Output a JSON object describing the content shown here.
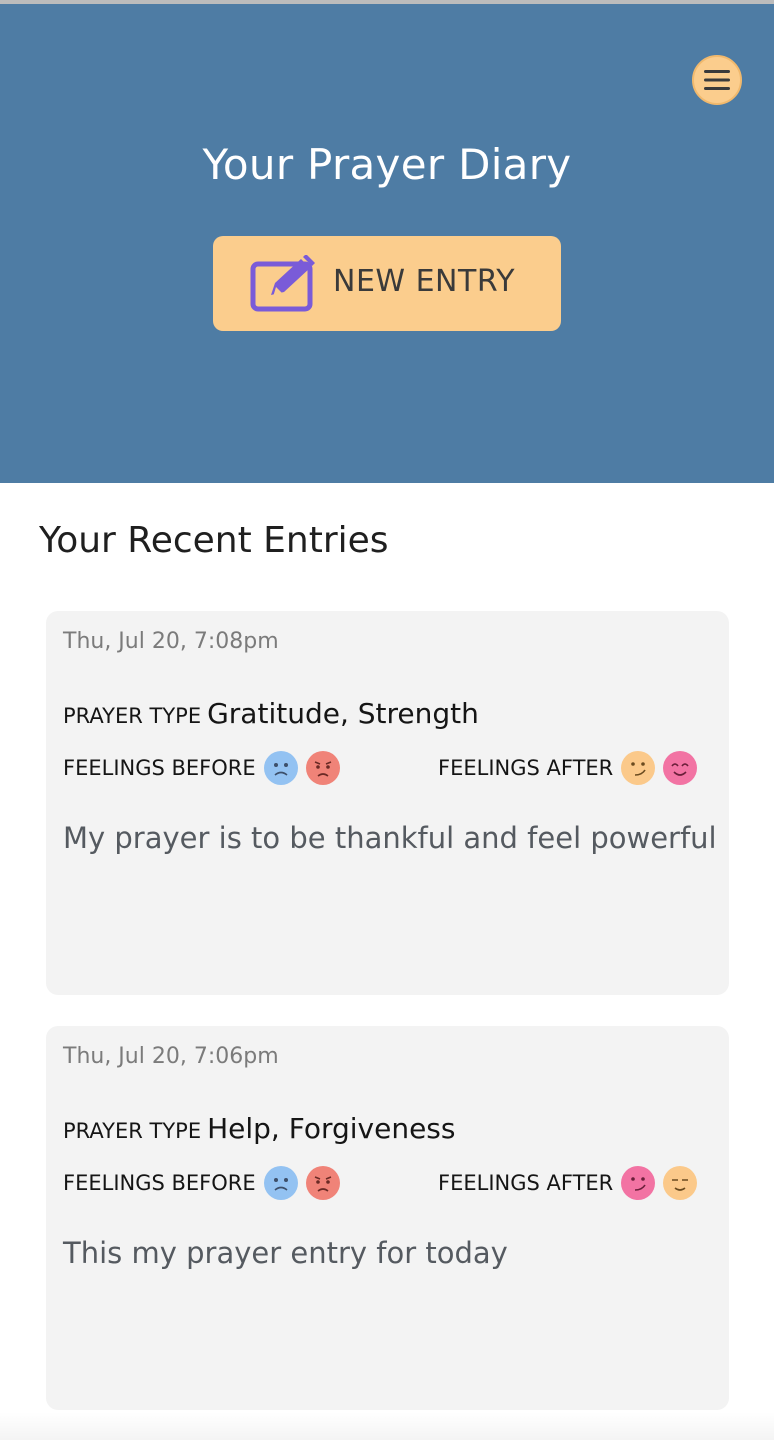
{
  "header": {
    "title": "Your Prayer Diary",
    "new_entry_label": "NEW ENTRY",
    "menu_icon": "hamburger-menu-icon",
    "new_entry_icon": "edit-icon"
  },
  "section_title": "Your Recent Entries",
  "labels": {
    "prayer_type": "PRAYER TYPE",
    "feelings_before": "FEELINGS BEFORE",
    "feelings_after": "FEELINGS AFTER"
  },
  "entries": [
    {
      "date": "Thu, Jul 20, 7:08pm",
      "prayer_type": "Gratitude, Strength",
      "feelings_before": [
        {
          "icon": "sad-face-icon",
          "color": "#93c2f2"
        },
        {
          "icon": "angry-face-icon",
          "color": "#f08378"
        }
      ],
      "feelings_after": [
        {
          "icon": "smirk-face-icon",
          "color": "#fbc98a"
        },
        {
          "icon": "smiling-face-icon",
          "color": "#f273a3"
        }
      ],
      "text": "My prayer is to be thankful and feel powerful"
    },
    {
      "date": "Thu, Jul 20, 7:06pm",
      "prayer_type": "Help, Forgiveness",
      "feelings_before": [
        {
          "icon": "sad-face-icon",
          "color": "#93c2f2"
        },
        {
          "icon": "angry-face-icon",
          "color": "#f08378"
        }
      ],
      "feelings_after": [
        {
          "icon": "smirk-face-icon",
          "color": "#f273a3"
        },
        {
          "icon": "content-face-icon",
          "color": "#fbc98a"
        }
      ],
      "text": "This my prayer entry for today"
    }
  ],
  "colors": {
    "header_bg": "#4e7ca4",
    "accent": "#fbcd8d",
    "icon_purple": "#7a5bd8",
    "card_bg": "#f3f3f3"
  }
}
